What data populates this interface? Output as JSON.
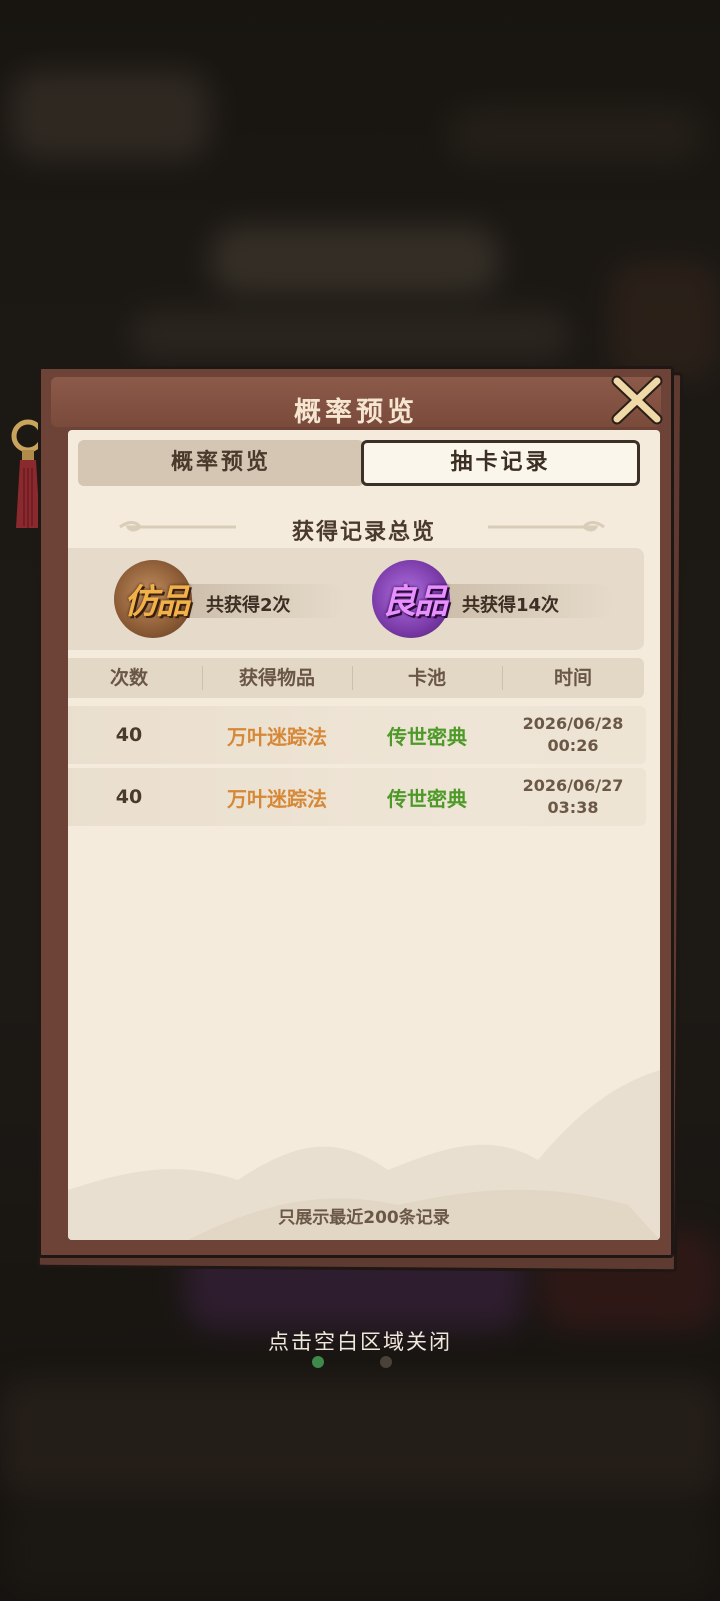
{
  "dialog": {
    "title": "概率预览",
    "tabs": [
      {
        "label": "概率预览",
        "active": false
      },
      {
        "label": "抽卡记录",
        "active": true
      }
    ],
    "summary_title": "获得记录总览",
    "summary": [
      {
        "rarity": "仿品",
        "text": "共获得2次",
        "color": "#e8a040"
      },
      {
        "rarity": "良品",
        "text": "共获得14次",
        "color": "#b04ad8"
      }
    ],
    "columns": [
      "次数",
      "获得物品",
      "卡池",
      "时间"
    ],
    "rows": [
      {
        "count": "40",
        "item": "万叶迷踪法",
        "pool": "传世密典",
        "date": "2026/06/28",
        "time": "00:26"
      },
      {
        "count": "40",
        "item": "万叶迷踪法",
        "pool": "传世密典",
        "date": "2026/06/27",
        "time": "03:38"
      }
    ],
    "footnote": "只展示最近200条记录"
  },
  "close_hint": "点击空白区域关闭",
  "colors": {
    "item_orange": "#d68837",
    "pool_green": "#4d9a28",
    "title_bar": "#8c5a49",
    "panel": "#f4ebdd"
  },
  "icons": {
    "close": "close-x-icon"
  }
}
